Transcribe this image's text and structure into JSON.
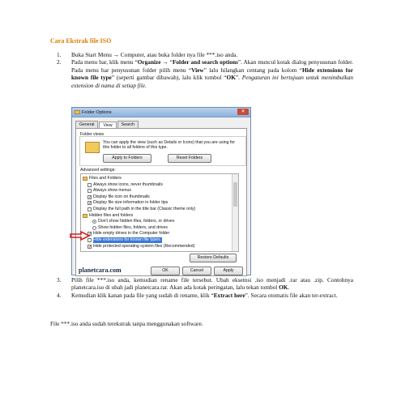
{
  "heading": "Cara Ekstrak file ISO",
  "steps": [
    {
      "num": "1.",
      "text": "Buka Start Menu → Computer, atau buka folder nya file ***.iso anda."
    },
    {
      "num": "2.",
      "pre": "Pada menu bar, klik menu “",
      "b1": "Organize",
      "mid1": " → “",
      "b2": "Folder and search options",
      "mid2": "”. Akan muncul kotak dialog penyusunan folder. Pada menu bar penyusunan folder pilih menu “",
      "b3": "View",
      "mid3": "” lalu hilangkan centang pada kolom “",
      "b4": "Hide extensions for known file type",
      "mid4": "” (seperti gambar dibawah), lalu klik tombol “",
      "b5": "OK",
      "mid5": "”. ",
      "italic": "Pengaturan ini bertujuan untuk menimbulkan extension di nama di setiap file."
    },
    {
      "num": "3.",
      "pre": "Pilih file ***.iso anda, kemudian rename file tersebut. Ubah eksetnsi .iso menjadi .rar atau .zip. Contohnya planetcara.iso di ubah jadi planetcara.rar. Akan ada kotak peringatan, lalu tekan tombol ",
      "b1": "OK",
      "post": "."
    },
    {
      "num": "4.",
      "pre": "Kemudian klik kanan pada file yang sudah di rename, klik “",
      "b1": "Extract here",
      "post": "”. Secara otomatis file akan ter-extract."
    }
  ],
  "final_text": "File ***.iso anda sudah terekstrak tanpa menggunakan software.",
  "dialog": {
    "title": "Folder Options",
    "tabs": [
      "General",
      "View",
      "Search"
    ],
    "folder_views_label": "Folder views",
    "folder_views_text": "You can apply the view (such as Details or Icons) that you are using for this folder to all folders of this type.",
    "apply_button": "Apply to Folders",
    "reset_button": "Reset Folders",
    "advanced_label": "Advanced settings:",
    "tree": [
      {
        "kind": "folder",
        "label": "Files and Folders"
      },
      {
        "kind": "check",
        "checked": false,
        "label": "Always show icons, never thumbnails"
      },
      {
        "kind": "check",
        "checked": false,
        "label": "Always show menus"
      },
      {
        "kind": "check",
        "checked": true,
        "label": "Display file icon on thumbnails"
      },
      {
        "kind": "check",
        "checked": true,
        "label": "Display file size information in folder tips"
      },
      {
        "kind": "check",
        "checked": false,
        "label": "Display the full path in the title bar (Classic theme only)"
      },
      {
        "kind": "folder",
        "label": "Hidden files and folders"
      },
      {
        "kind": "radio",
        "checked": true,
        "label": "Don't show hidden files, folders, or drives"
      },
      {
        "kind": "radio",
        "checked": false,
        "label": "Show hidden files, folders, and drives"
      },
      {
        "kind": "check",
        "checked": true,
        "label": "Hide empty drives in the Computer folder"
      },
      {
        "kind": "check",
        "checked": false,
        "label": "Hide extensions for known file types",
        "highlight": true
      },
      {
        "kind": "check",
        "checked": true,
        "label": "Hide protected operating system files (Recommended)"
      }
    ],
    "restore_button": "Restore Defaults",
    "ok_button": "OK",
    "cancel_button": "Cancel",
    "apply_bottom_button": "Apply",
    "watermark": "planetcara.com"
  },
  "colors": {
    "heading": "#e07b00",
    "highlight": "#3a78d6",
    "arrow": "#d42020"
  }
}
